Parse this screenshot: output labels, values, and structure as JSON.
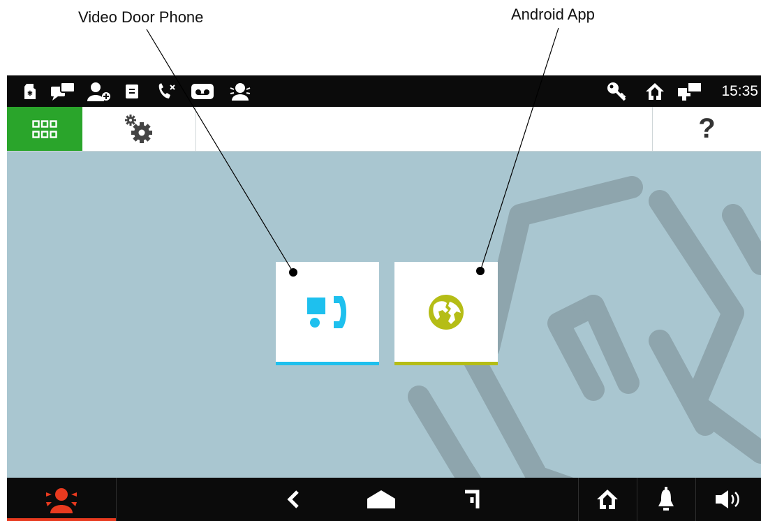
{
  "callouts": {
    "video_door_phone": "Video Door Phone",
    "android_app": "Android App"
  },
  "statusbar": {
    "left_icons": [
      "sd-card-icon",
      "messages-icon",
      "user-add-icon",
      "door-intercom-icon",
      "missed-call-icon",
      "voicemail-icon",
      "alarm-person-icon"
    ],
    "right_icons": [
      "key-icon",
      "home-icon",
      "network-icon"
    ],
    "time": "15:35"
  },
  "topbar": {
    "apps_icon": "apps-grid-icon",
    "settings_icon": "settings-gears-icon",
    "help_label": "?"
  },
  "tiles": [
    {
      "name": "Video Door Phone",
      "icon": "video-door-phone-icon",
      "accent": "#1ec0ee"
    },
    {
      "name": "Android App",
      "icon": "globe-icon",
      "accent": "#b5bd16"
    }
  ],
  "navbar": {
    "panic_icon": "panic-alarm-icon",
    "panic_color": "#e83a1f",
    "back_icon": "back-chevron-icon",
    "home_icon": "home-pentagon-icon",
    "recents_icon": "recents-icon",
    "house_icon": "house-icon",
    "bell_icon": "bell-icon",
    "volume_icon": "volume-icon"
  },
  "colors": {
    "background": "#a9c6d0",
    "apps_button": "#2aa52b",
    "bar": "#0b0b0b"
  }
}
